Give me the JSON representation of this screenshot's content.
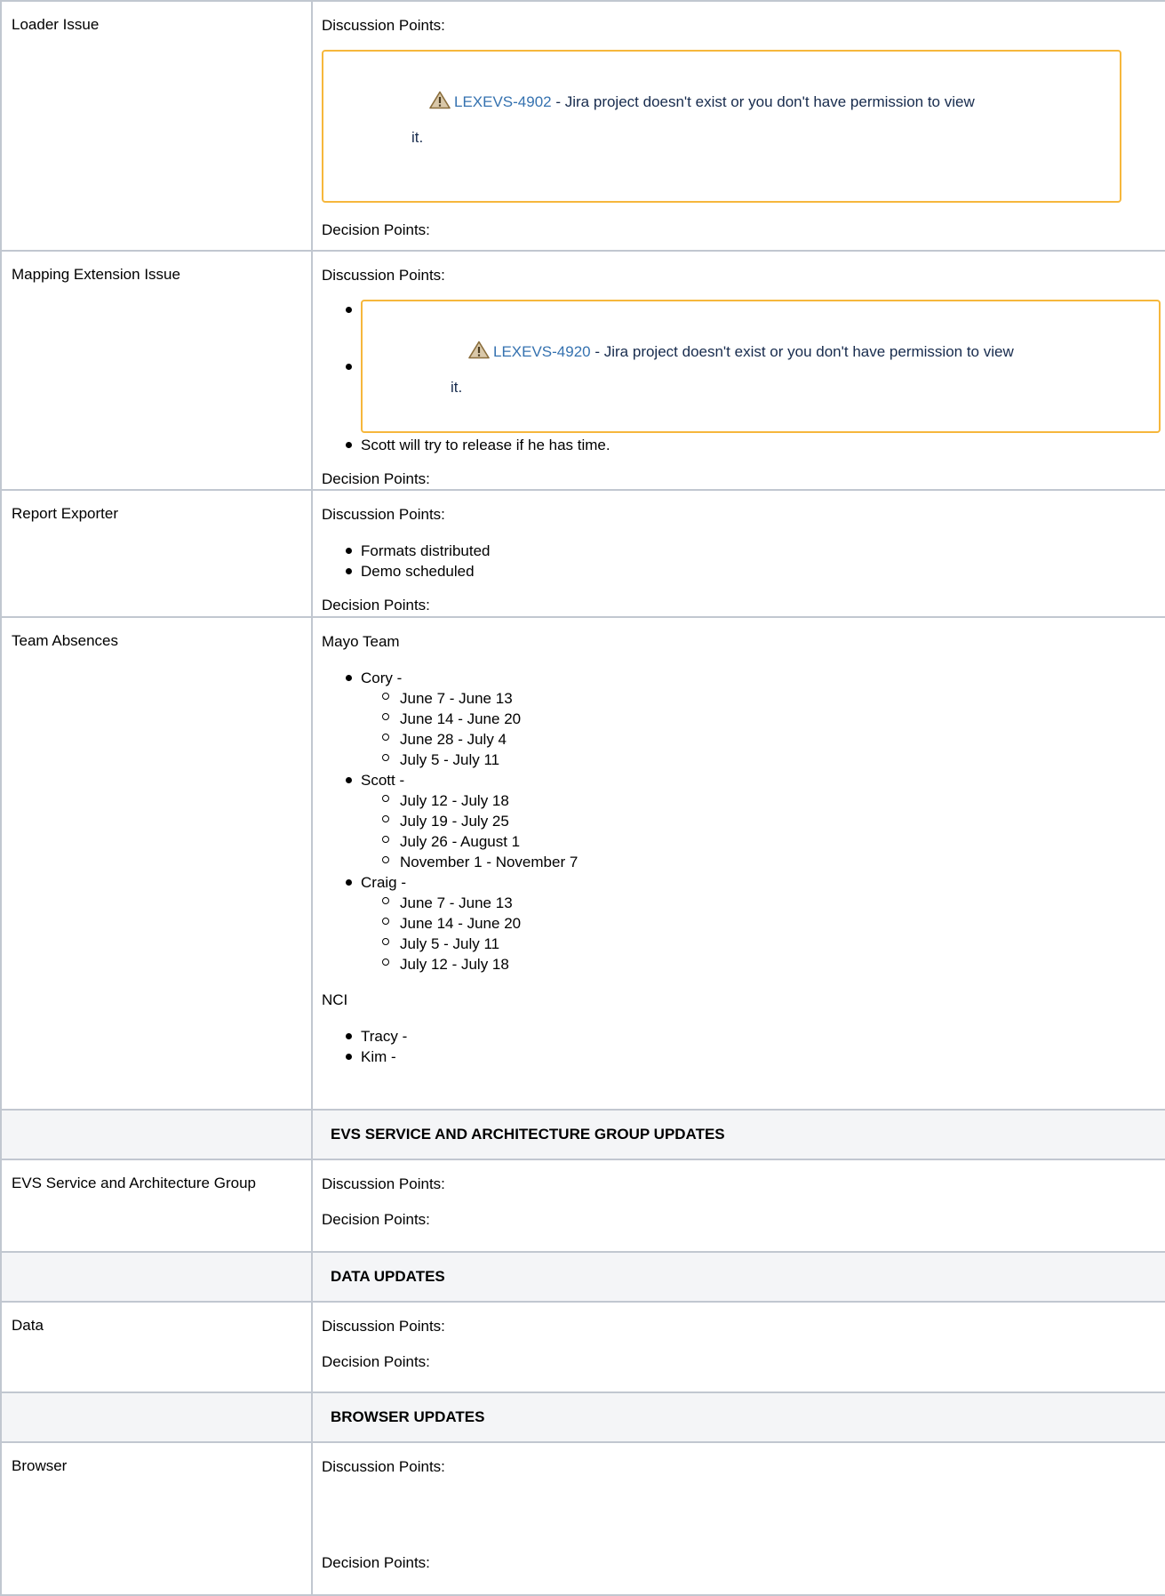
{
  "rows": {
    "loader": {
      "label": "Loader Issue",
      "discussion": "Discussion Points:",
      "jira_key": "LEXEVS-4902",
      "jira_msg_1": " - Jira project doesn't exist or you don't have permission to view",
      "jira_msg_2": "it.",
      "decision": "Decision Points:"
    },
    "mapping": {
      "label": "Mapping Extension Issue",
      "discussion": "Discussion Points:",
      "jira_key": "LEXEVS-4920",
      "jira_msg_1": " - Jira project doesn't exist or you don't have permission to view",
      "jira_msg_2": "it.",
      "bullet_2": "Scott will try to release if he has time.",
      "decision": "Decision Points:"
    },
    "report": {
      "label": "Report Exporter",
      "discussion": "Discussion Points:",
      "bullets": [
        "Formats distributed",
        "Demo scheduled"
      ],
      "decision": "Decision Points:"
    },
    "absences": {
      "label": "Team Absences",
      "mayo_heading": "Mayo Team",
      "people": [
        {
          "name": "Cory -",
          "dates": [
            "June 7 - June 13",
            "June 14 - June 20",
            "June 28 - July 4",
            "July 5 - July 11"
          ]
        },
        {
          "name": "Scott -",
          "dates": [
            "July 12 - July 18",
            "July 19 - July 25",
            "July 26 - August 1",
            "November 1 - November 7"
          ]
        },
        {
          "name": "Craig -",
          "dates": [
            "June 7 - June 13",
            "June 14 - June 20",
            "July 5 - July 11",
            "July 12 - July 18"
          ]
        }
      ],
      "nci_heading": "NCI",
      "nci_people": [
        "Tracy -",
        "Kim -"
      ]
    },
    "evs_section": "EVS SERVICE AND ARCHITECTURE GROUP UPDATES",
    "evs": {
      "label": "EVS Service and Architecture Group",
      "discussion": "Discussion Points:",
      "decision": "Decision Points:"
    },
    "data_section": "DATA UPDATES",
    "data": {
      "label": "Data",
      "discussion": "Discussion Points:",
      "decision": "Decision Points:"
    },
    "browser_section": "BROWSER UPDATES",
    "browser": {
      "label": "Browser",
      "discussion": "Discussion Points:",
      "decision": "Decision Points:"
    }
  },
  "colors": {
    "border": "#c1c7d0",
    "section_bg": "#f4f5f7",
    "jira_border": "#f6b73c",
    "link": "#3572b0"
  },
  "icons": {
    "warning": "warning-triangle-icon"
  }
}
